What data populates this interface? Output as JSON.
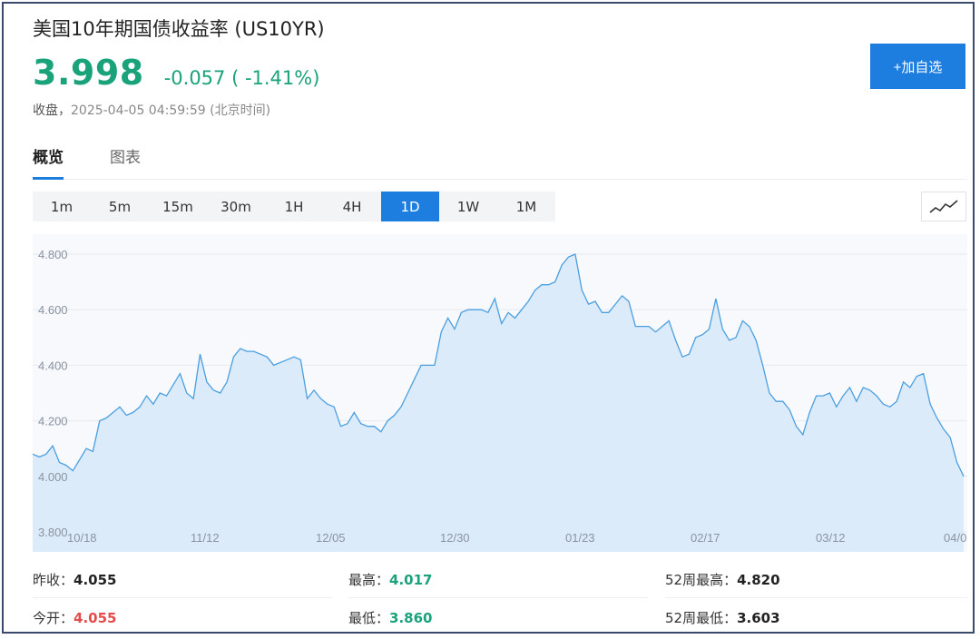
{
  "header": {
    "title": "美国10年期国债收益率 (US10YR)",
    "price": "3.998",
    "change": "-0.057 ( -1.41%)",
    "status_label": "收盘，",
    "status_time": "2025-04-05 04:59:59 (北京时间)",
    "add_button": "+加自选"
  },
  "tabs": [
    {
      "label": "概览",
      "active": true
    },
    {
      "label": "图表",
      "active": false
    }
  ],
  "periods": [
    {
      "label": "1m",
      "active": false
    },
    {
      "label": "5m",
      "active": false
    },
    {
      "label": "15m",
      "active": false
    },
    {
      "label": "30m",
      "active": false
    },
    {
      "label": "1H",
      "active": false
    },
    {
      "label": "4H",
      "active": false
    },
    {
      "label": "1D",
      "active": true
    },
    {
      "label": "1W",
      "active": false
    },
    {
      "label": "1M",
      "active": false
    }
  ],
  "chart_toggle_icon": "line-chart-icon",
  "colors": {
    "up_green": "#1aa37a",
    "down_red": "#e54b4b",
    "accent_blue": "#1e7ee0",
    "line": "#4a9fe0",
    "fill": "#dcebfa"
  },
  "chart_data": {
    "type": "area",
    "ylim": [
      3.8,
      4.8
    ],
    "yticks": [
      "4.800",
      "4.600",
      "4.400",
      "4.200",
      "4.000",
      "3.800"
    ],
    "xticks": [
      "10/18",
      "11/12",
      "12/05",
      "12/30",
      "01/23",
      "02/17",
      "03/12",
      "04/0"
    ],
    "grid": true,
    "series": [
      {
        "values": [
          4.08,
          4.07,
          4.08,
          4.11,
          4.05,
          4.04,
          4.02,
          4.06,
          4.1,
          4.09,
          4.2,
          4.21,
          4.23,
          4.25,
          4.22,
          4.23,
          4.25,
          4.29,
          4.26,
          4.3,
          4.29,
          4.33,
          4.37,
          4.3,
          4.28,
          4.44,
          4.34,
          4.31,
          4.3,
          4.34,
          4.43,
          4.46,
          4.45,
          4.45,
          4.44,
          4.43,
          4.4,
          4.41,
          4.42,
          4.43,
          4.42,
          4.28,
          4.31,
          4.28,
          4.26,
          4.25,
          4.18,
          4.19,
          4.23,
          4.19,
          4.18,
          4.18,
          4.16,
          4.2,
          4.22,
          4.25,
          4.3,
          4.35,
          4.4,
          4.4,
          4.4,
          4.52,
          4.57,
          4.53,
          4.59,
          4.6,
          4.6,
          4.6,
          4.59,
          4.64,
          4.55,
          4.59,
          4.57,
          4.6,
          4.63,
          4.67,
          4.69,
          4.69,
          4.7,
          4.76,
          4.79,
          4.8,
          4.67,
          4.62,
          4.63,
          4.59,
          4.59,
          4.62,
          4.65,
          4.63,
          4.54,
          4.54,
          4.54,
          4.52,
          4.54,
          4.56,
          4.49,
          4.43,
          4.44,
          4.5,
          4.51,
          4.53,
          4.64,
          4.53,
          4.49,
          4.5,
          4.56,
          4.54,
          4.49,
          4.4,
          4.3,
          4.27,
          4.27,
          4.24,
          4.18,
          4.15,
          4.23,
          4.29,
          4.29,
          4.3,
          4.25,
          4.29,
          4.32,
          4.27,
          4.32,
          4.31,
          4.29,
          4.26,
          4.25,
          4.27,
          4.34,
          4.32,
          4.36,
          4.37,
          4.26,
          4.21,
          4.17,
          4.14,
          4.05,
          4.0
        ]
      }
    ]
  },
  "stats": {
    "prev_close_label": "昨收：",
    "prev_close": "4.055",
    "high_label": "最高：",
    "high": "4.017",
    "high52_label": "52周最高：",
    "high52": "4.820",
    "open_label": "今开：",
    "open": "4.055",
    "low_label": "最低：",
    "low": "3.860",
    "low52_label": "52周最低：",
    "low52": "3.603"
  }
}
